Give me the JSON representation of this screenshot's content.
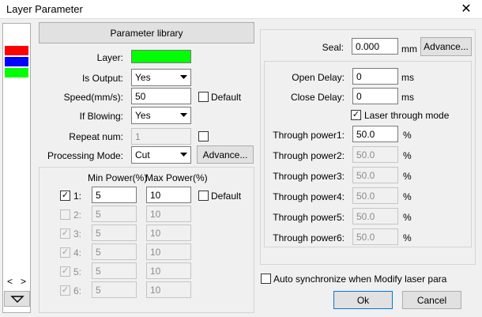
{
  "window": {
    "title": "Layer Parameter",
    "close_glyph": "✕"
  },
  "layers_strip": {
    "colors": [
      "#ff0000",
      "#0000ff",
      "#00ff00"
    ],
    "scroll_left": "<",
    "scroll_right": ">"
  },
  "left": {
    "parameter_library": "Parameter library",
    "layer_label": "Layer:",
    "layer_color": "#00ff00",
    "is_output_label": "Is Output:",
    "is_output_value": "Yes",
    "speed_label": "Speed(mm/s):",
    "speed_value": "50",
    "default_label": "Default",
    "if_blowing_label": "If Blowing:",
    "if_blowing_value": "Yes",
    "repeat_label": "Repeat num:",
    "repeat_value": "1",
    "processing_mode_label": "Processing Mode:",
    "processing_mode_value": "Cut",
    "advance_label": "Advance...",
    "min_power_header": "Min Power(%)",
    "max_power_header": "Max Power(%)",
    "power_rows": [
      {
        "label": "1:",
        "min": "5",
        "max": "10",
        "checked": true,
        "enabled": true
      },
      {
        "label": "2:",
        "min": "5",
        "max": "10",
        "checked": false,
        "enabled": false
      },
      {
        "label": "3:",
        "min": "5",
        "max": "10",
        "checked": true,
        "enabled": false
      },
      {
        "label": "4:",
        "min": "5",
        "max": "10",
        "checked": true,
        "enabled": false
      },
      {
        "label": "5:",
        "min": "5",
        "max": "10",
        "checked": true,
        "enabled": false
      },
      {
        "label": "6:",
        "min": "5",
        "max": "10",
        "checked": true,
        "enabled": false
      }
    ],
    "power_default_label": "Default"
  },
  "right": {
    "seal_label": "Seal:",
    "seal_value": "0.000",
    "seal_unit": "mm",
    "advance_label": "Advance...",
    "open_delay_label": "Open Delay:",
    "open_delay_value": "0",
    "close_delay_label": "Close Delay:",
    "close_delay_value": "0",
    "delay_unit": "ms",
    "laser_through_label": "Laser through mode",
    "through": [
      {
        "label": "Through power1:",
        "value": "50.0",
        "enabled": true
      },
      {
        "label": "Through power2:",
        "value": "50.0",
        "enabled": false
      },
      {
        "label": "Through power3:",
        "value": "50.0",
        "enabled": false
      },
      {
        "label": "Through power4:",
        "value": "50.0",
        "enabled": false
      },
      {
        "label": "Through power5:",
        "value": "50.0",
        "enabled": false
      },
      {
        "label": "Through power6:",
        "value": "50.0",
        "enabled": false
      }
    ],
    "percent": "%",
    "auto_sync_label": "Auto synchronize when Modify laser para",
    "ok_label": "Ok",
    "cancel_label": "Cancel"
  },
  "icons": {
    "scroll_up": "up-arrow-icon",
    "scroll_down": "down-arrow-icon",
    "dropdown": "chevron-down-icon"
  }
}
